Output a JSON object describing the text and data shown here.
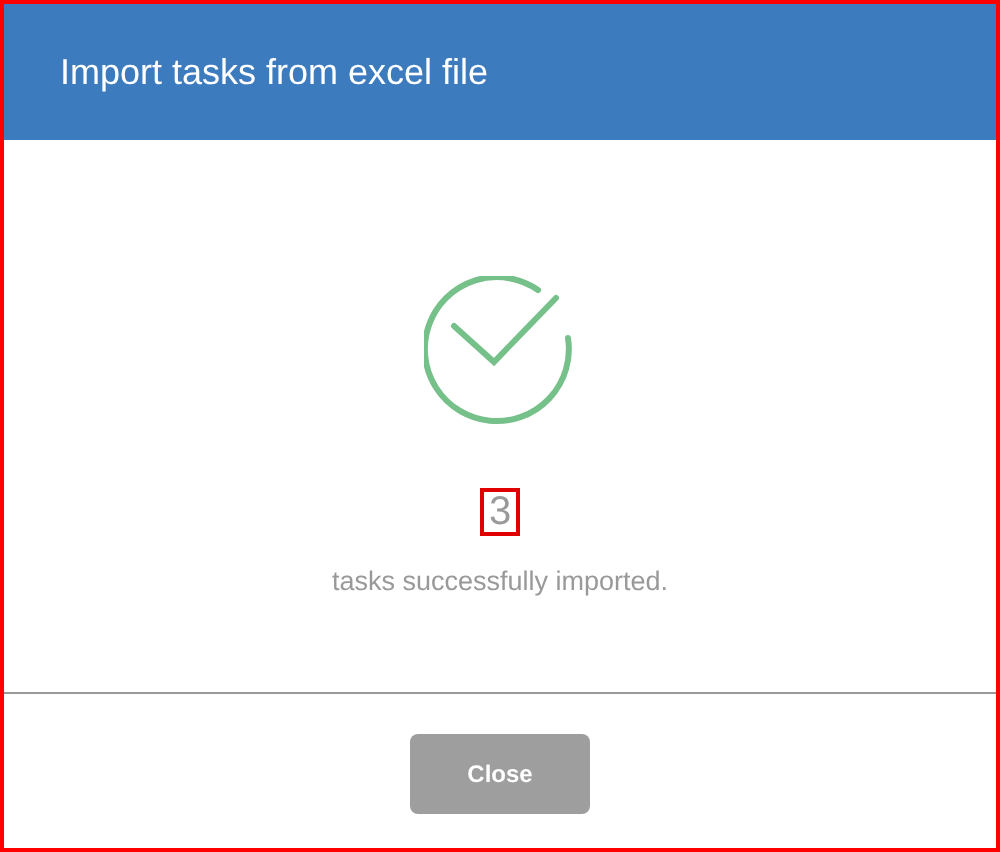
{
  "dialog": {
    "title": "Import tasks from excel file"
  },
  "result": {
    "count": "3",
    "message": "tasks successfully imported."
  },
  "buttons": [
    {
      "label": "Close",
      "disabled": true
    }
  ]
}
